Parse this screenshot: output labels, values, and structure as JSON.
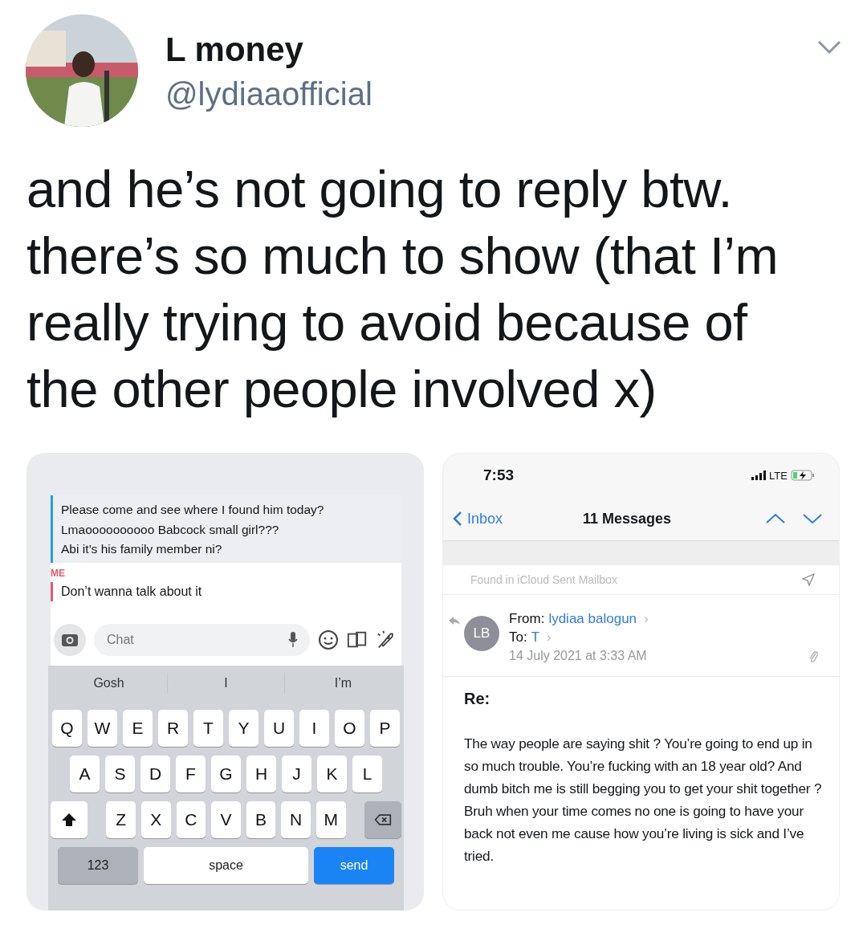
{
  "tweet": {
    "name": "L money",
    "handle": "@lydiaaofficial",
    "text": "and he’s not going to reply btw. there’s so much to show (that I’m really trying to avoid because of the other people involved x)"
  },
  "chat": {
    "quoted_lines": [
      "Please come and see where I found him today?",
      "Lmaoooooooooo Babcock small girl???",
      "Abi it’s his family member ni?"
    ],
    "sender": "ME",
    "reply": "Don’t wanna talk about it",
    "input": {
      "placeholder": "Chat"
    },
    "suggestions": [
      "Gosh",
      "I",
      "I’m"
    ],
    "key_rows": [
      [
        "Q",
        "W",
        "E",
        "R",
        "T",
        "Y",
        "U",
        "I",
        "O",
        "P"
      ],
      [
        "A",
        "S",
        "D",
        "F",
        "G",
        "H",
        "J",
        "K",
        "L"
      ],
      [
        "Z",
        "X",
        "C",
        "V",
        "B",
        "N",
        "M"
      ]
    ],
    "bottom_keys": [
      {
        "label": "123",
        "kind": "mode"
      },
      {
        "label": "space",
        "kind": "space"
      },
      {
        "label": "send",
        "kind": "action"
      }
    ]
  },
  "mail": {
    "time": "7:53",
    "network": "LTE",
    "back": "Inbox",
    "title": "11 Messages",
    "found_in": "Found in iCloud Sent Mailbox",
    "avatar": "LB",
    "from_label": "From:",
    "from": "lydiaa balogun",
    "from_arrow": "›",
    "to_label": "To:",
    "to": "T",
    "to_arrow": "›",
    "date": "14 July 2021 at 3:33 AM",
    "subject": "Re:",
    "body": "The way people are saying shit ? You’re going to end up in so much trouble. You’re fucking with an 18 year old? And dumb bitch me is still begging you to get your shit together ? Bruh when your time comes no one is going to have your back not even me cause how you’re living is sick and I’ve tried."
  }
}
